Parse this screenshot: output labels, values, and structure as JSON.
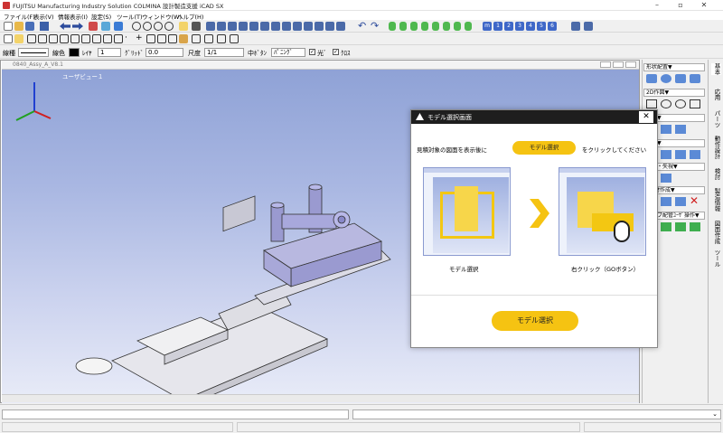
{
  "window": {
    "title": "FUJITSU Manufacturing Industry Solution COLMINA 設計製造支援 iCAD SX"
  },
  "menu": [
    "ファイル(F)",
    "表示(V)",
    "情報表示(I)",
    "設定(S)",
    "ツール(T)",
    "ウィンドウ(W)",
    "ヘルプ(H)"
  ],
  "props": {
    "line_type_label": "線種",
    "line_color_label": "線色",
    "layer_label": "ﾚｲﾔ",
    "layer_value": "1",
    "grid_label": "ｸﾞﾘｯﾄﾞ",
    "grid_value": "0.0",
    "scale_label": "尺度",
    "scale_value": "1/1",
    "middle_btn_label": "中ﾎﾞﾀﾝ",
    "panning_value": "ﾊﾟﾆﾝｸﾞ",
    "light_label": "光ﾞ",
    "cross_label": "ｸﾛｽ"
  },
  "child_window": {
    "title": "0840_Assy_A_V8.1",
    "view_label": "ユーザビュー１"
  },
  "right_panel": {
    "headers": [
      "形状配置▼",
      "2D作図▼",
      "補正▼",
      "操作▼",
      "断面・矢視▼",
      "ﾋﾞｰ材作成▼",
      "パイプ配管ﾕｰｻﾞ操作▼"
    ]
  },
  "side_tabs": [
    "基本",
    "応用",
    "パーツ",
    "動作設計",
    "検討",
    "製造情報",
    "図面作成",
    "ツール"
  ],
  "dialog": {
    "title": "モデル選択画面",
    "instruction_before": "見積対象の図面を表示後に",
    "inline_button": "モデル選択",
    "instruction_after": "をクリックしてください",
    "image1_caption": "モデル選択",
    "image2_caption": "右クリック（GOボタン）",
    "main_button": "モデル選択",
    "close": "✕"
  },
  "colors": {
    "accent_yellow": "#f5c312",
    "dialog_titlebar": "#1e1e1e",
    "viewport_top": "#8fa2d6"
  }
}
